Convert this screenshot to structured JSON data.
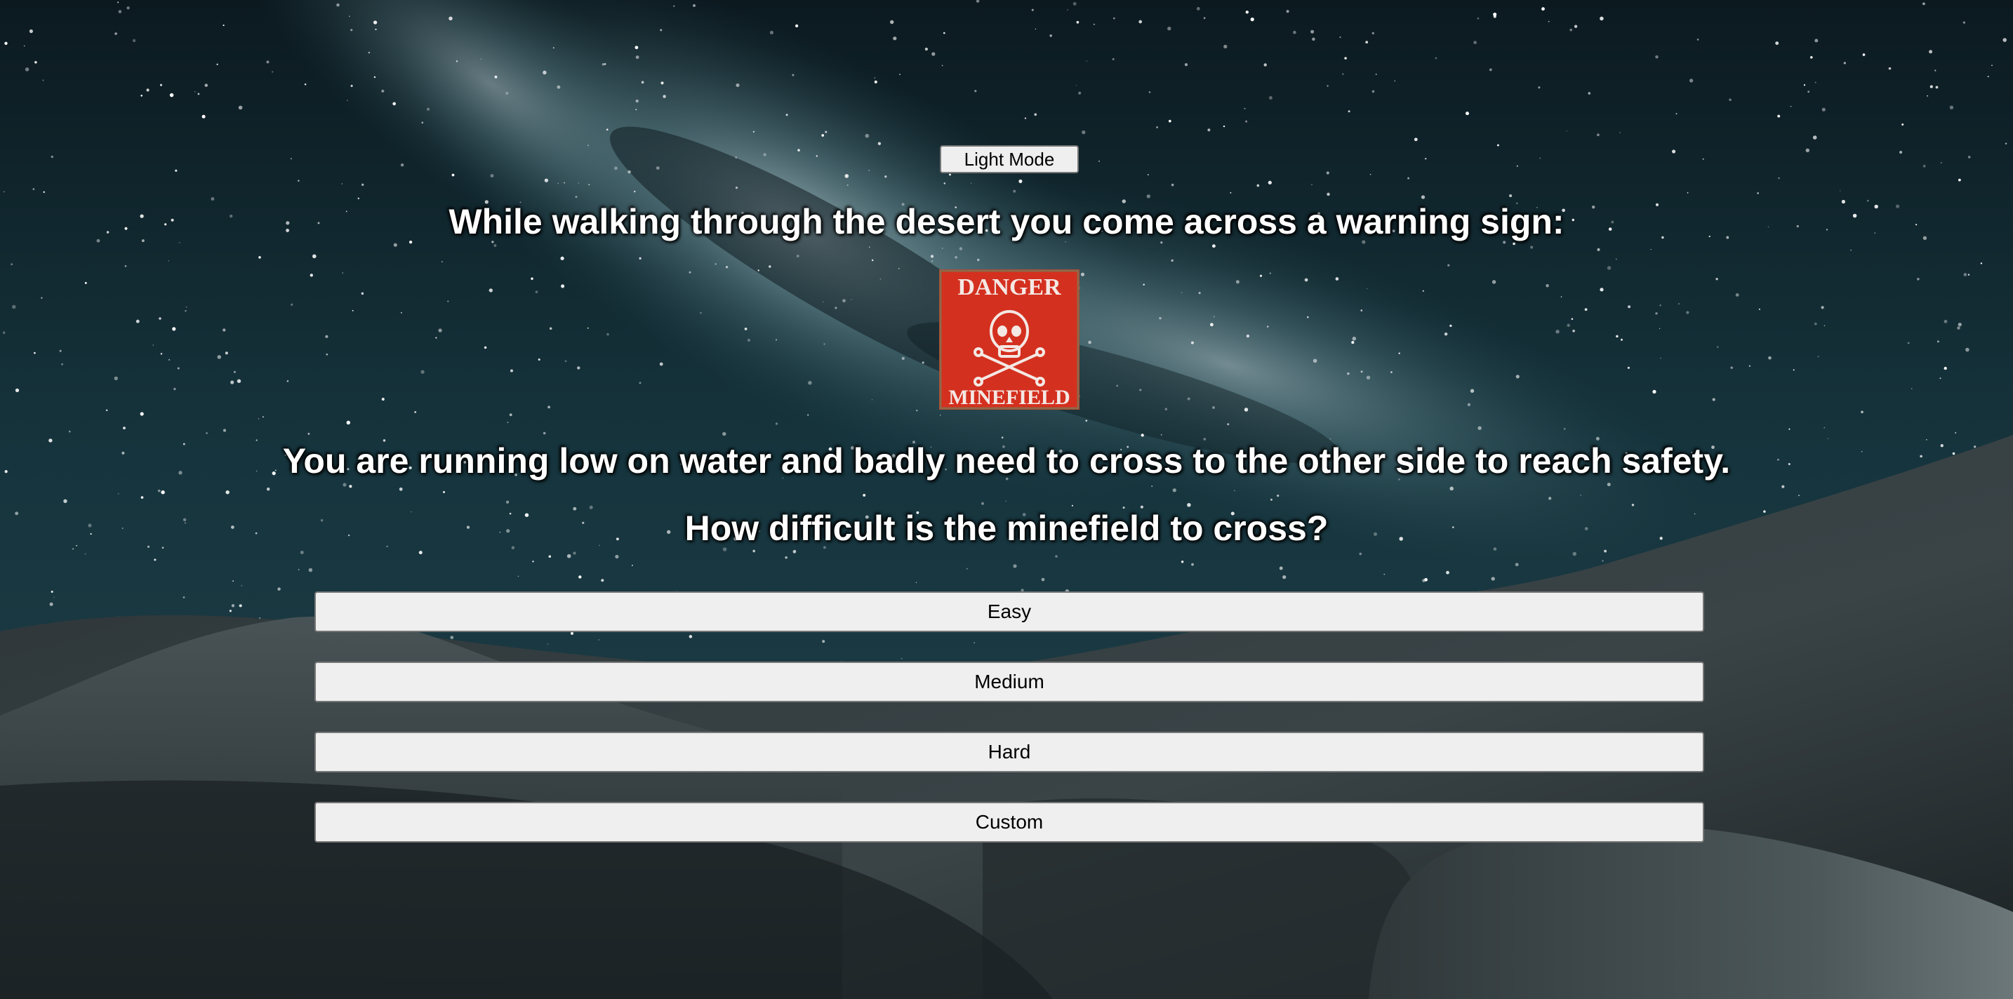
{
  "mode_toggle": {
    "label": "Light Mode"
  },
  "intro_text": "While walking through the desert you come across a warning sign:",
  "sign": {
    "top_text": "DANGER",
    "bottom_text": "MINEFIELD",
    "color": "#d4301f"
  },
  "story_text": "You are running low on water and badly need to cross to the other side to reach safety.",
  "question_text": "How difficult is the minefield to cross?",
  "difficulty_options": [
    {
      "label": "Easy"
    },
    {
      "label": "Medium"
    },
    {
      "label": "Hard"
    },
    {
      "label": "Custom"
    }
  ]
}
